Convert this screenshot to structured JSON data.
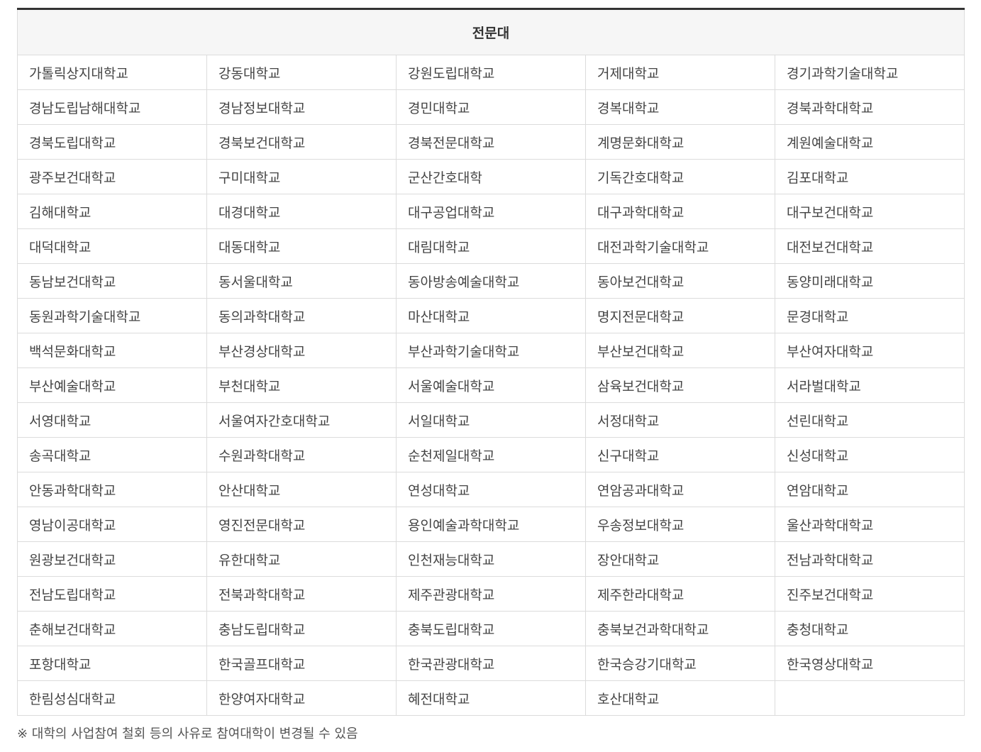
{
  "table": {
    "header": "전문대",
    "rows": [
      [
        "가톨릭상지대학교",
        "강동대학교",
        "강원도립대학교",
        "거제대학교",
        "경기과학기술대학교"
      ],
      [
        "경남도립남해대학교",
        "경남정보대학교",
        "경민대학교",
        "경복대학교",
        "경북과학대학교"
      ],
      [
        "경북도립대학교",
        "경북보건대학교",
        "경북전문대학교",
        "계명문화대학교",
        "계원예술대학교"
      ],
      [
        "광주보건대학교",
        "구미대학교",
        "군산간호대학",
        "기독간호대학교",
        "김포대학교"
      ],
      [
        "김해대학교",
        "대경대학교",
        "대구공업대학교",
        "대구과학대학교",
        "대구보건대학교"
      ],
      [
        "대덕대학교",
        "대동대학교",
        "대림대학교",
        "대전과학기술대학교",
        "대전보건대학교"
      ],
      [
        "동남보건대학교",
        "동서울대학교",
        "동아방송예술대학교",
        "동아보건대학교",
        "동양미래대학교"
      ],
      [
        "동원과학기술대학교",
        "동의과학대학교",
        "마산대학교",
        "명지전문대학교",
        "문경대학교"
      ],
      [
        "백석문화대학교",
        "부산경상대학교",
        "부산과학기술대학교",
        "부산보건대학교",
        "부산여자대학교"
      ],
      [
        "부산예술대학교",
        "부천대학교",
        "서울예술대학교",
        "삼육보건대학교",
        "서라벌대학교"
      ],
      [
        "서영대학교",
        "서울여자간호대학교",
        "서일대학교",
        "서정대학교",
        "선린대학교"
      ],
      [
        "송곡대학교",
        "수원과학대학교",
        "순천제일대학교",
        "신구대학교",
        "신성대학교"
      ],
      [
        "안동과학대학교",
        "안산대학교",
        "연성대학교",
        "연암공과대학교",
        "연암대학교"
      ],
      [
        "영남이공대학교",
        "영진전문대학교",
        "용인예술과학대학교",
        "우송정보대학교",
        "울산과학대학교"
      ],
      [
        "원광보건대학교",
        "유한대학교",
        "인천재능대학교",
        "장안대학교",
        "전남과학대학교"
      ],
      [
        "전남도립대학교",
        "전북과학대학교",
        "제주관광대학교",
        "제주한라대학교",
        "진주보건대학교"
      ],
      [
        "춘해보건대학교",
        "충남도립대학교",
        "충북도립대학교",
        "충북보건과학대학교",
        "충청대학교"
      ],
      [
        "포항대학교",
        "한국골프대학교",
        "한국관광대학교",
        "한국승강기대학교",
        "한국영상대학교"
      ],
      [
        "한림성심대학교",
        "한양여자대학교",
        "혜전대학교",
        "호산대학교",
        ""
      ]
    ]
  },
  "note": "※ 대학의 사업참여 철회 등의 사유로 참여대학이 변경될 수 있음"
}
